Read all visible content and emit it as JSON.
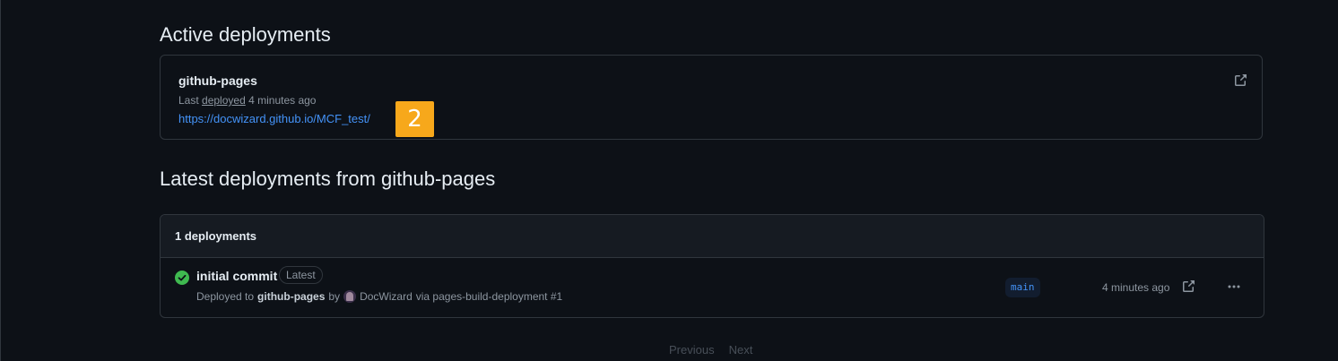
{
  "active": {
    "title": "Active deployments",
    "environment": "github-pages",
    "last_prefix": "Last",
    "last_link": "deployed",
    "last_suffix": "4 minutes ago",
    "url": "https://docwizard.github.io/MCF_test/",
    "annotation_badge": "2"
  },
  "latest": {
    "title": "Latest deployments from github-pages",
    "count_label": "1 deployments",
    "rows": [
      {
        "commit": "initial commit",
        "badge": "Latest",
        "deployed_to_prefix": "Deployed to",
        "environment": "github-pages",
        "by": "by",
        "user": "DocWizard",
        "via": "via pages-build-deployment #1",
        "branch": "main",
        "time": "4 minutes ago"
      }
    ]
  },
  "pagination": {
    "previous": "Previous",
    "next": "Next"
  },
  "icons": {
    "external": "link-external-icon",
    "check": "check-circle-fill-icon",
    "kebab": "kebab-horizontal-icon"
  },
  "colors": {
    "background": "#0d1117",
    "border": "#30363d",
    "link": "#4493f8",
    "success": "#3fb950",
    "annotation": "#f7a81b"
  }
}
